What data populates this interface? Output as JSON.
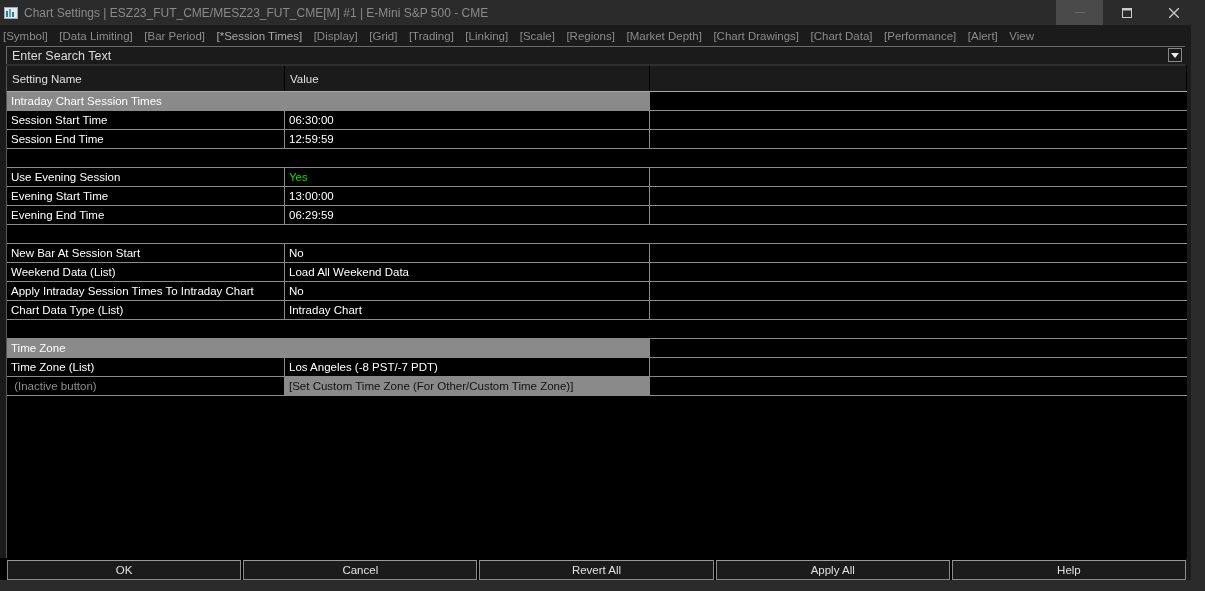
{
  "window": {
    "title": "Chart Settings | ESZ23_FUT_CME/MESZ23_FUT_CME[M] #1 | E-Mini S&P 500 - CME"
  },
  "menu": [
    {
      "label": "[Symbol]",
      "selected": false
    },
    {
      "label": "[Data Limiting]",
      "selected": false
    },
    {
      "label": "[Bar Period]",
      "selected": false
    },
    {
      "label": "[*Session Times]",
      "selected": true
    },
    {
      "label": "[Display]",
      "selected": false
    },
    {
      "label": "[Grid]",
      "selected": false
    },
    {
      "label": "[Trading]",
      "selected": false
    },
    {
      "label": "[Linking]",
      "selected": false
    },
    {
      "label": "[Scale]",
      "selected": false
    },
    {
      "label": "[Regions]",
      "selected": false
    },
    {
      "label": "[Market Depth]",
      "selected": false
    },
    {
      "label": "[Chart Drawings]",
      "selected": false
    },
    {
      "label": "[Chart Data]",
      "selected": false
    },
    {
      "label": "[Performance]",
      "selected": false
    },
    {
      "label": "[Alert]",
      "selected": false
    },
    {
      "label": "View",
      "selected": false
    }
  ],
  "search": {
    "placeholder": "Enter Search Text"
  },
  "table": {
    "columns": [
      "Setting Name",
      "Value"
    ],
    "rows": [
      {
        "kind": "section",
        "name": "Intraday Chart Session Times"
      },
      {
        "kind": "setting",
        "name": "Session Start Time",
        "value": "06:30:00",
        "highlighted": false
      },
      {
        "kind": "setting",
        "name": "Session End Time",
        "value": "12:59:59",
        "highlighted": false
      },
      {
        "kind": "blank"
      },
      {
        "kind": "setting",
        "name": "Use Evening Session",
        "value": "Yes",
        "highlighted": true
      },
      {
        "kind": "setting",
        "name": "Evening Start Time",
        "value": "13:00:00",
        "highlighted": false
      },
      {
        "kind": "setting",
        "name": "Evening End Time",
        "value": "06:29:59",
        "highlighted": false
      },
      {
        "kind": "blank"
      },
      {
        "kind": "setting",
        "name": "New Bar At Session Start",
        "value": "No",
        "highlighted": false
      },
      {
        "kind": "setting",
        "name": "Weekend Data (List)",
        "value": "Load All Weekend Data",
        "highlighted": false
      },
      {
        "kind": "setting",
        "name": "Apply Intraday Session Times To Intraday Chart",
        "value": "No",
        "highlighted": false
      },
      {
        "kind": "setting",
        "name": "Chart Data Type (List)",
        "value": "Intraday Chart",
        "highlighted": false
      },
      {
        "kind": "blank"
      },
      {
        "kind": "section",
        "name": "Time Zone"
      },
      {
        "kind": "setting",
        "name": "Time Zone (List)",
        "value": "Los Angeles (-8 PST/-7 PDT)",
        "highlighted": false
      },
      {
        "kind": "button",
        "name": " (Inactive button)",
        "value": "[Set Custom Time Zone (For Other/Custom Time Zone)]",
        "disabled": true
      }
    ]
  },
  "buttons": [
    "OK",
    "Cancel",
    "Revert All",
    "Apply All",
    "Help"
  ]
}
